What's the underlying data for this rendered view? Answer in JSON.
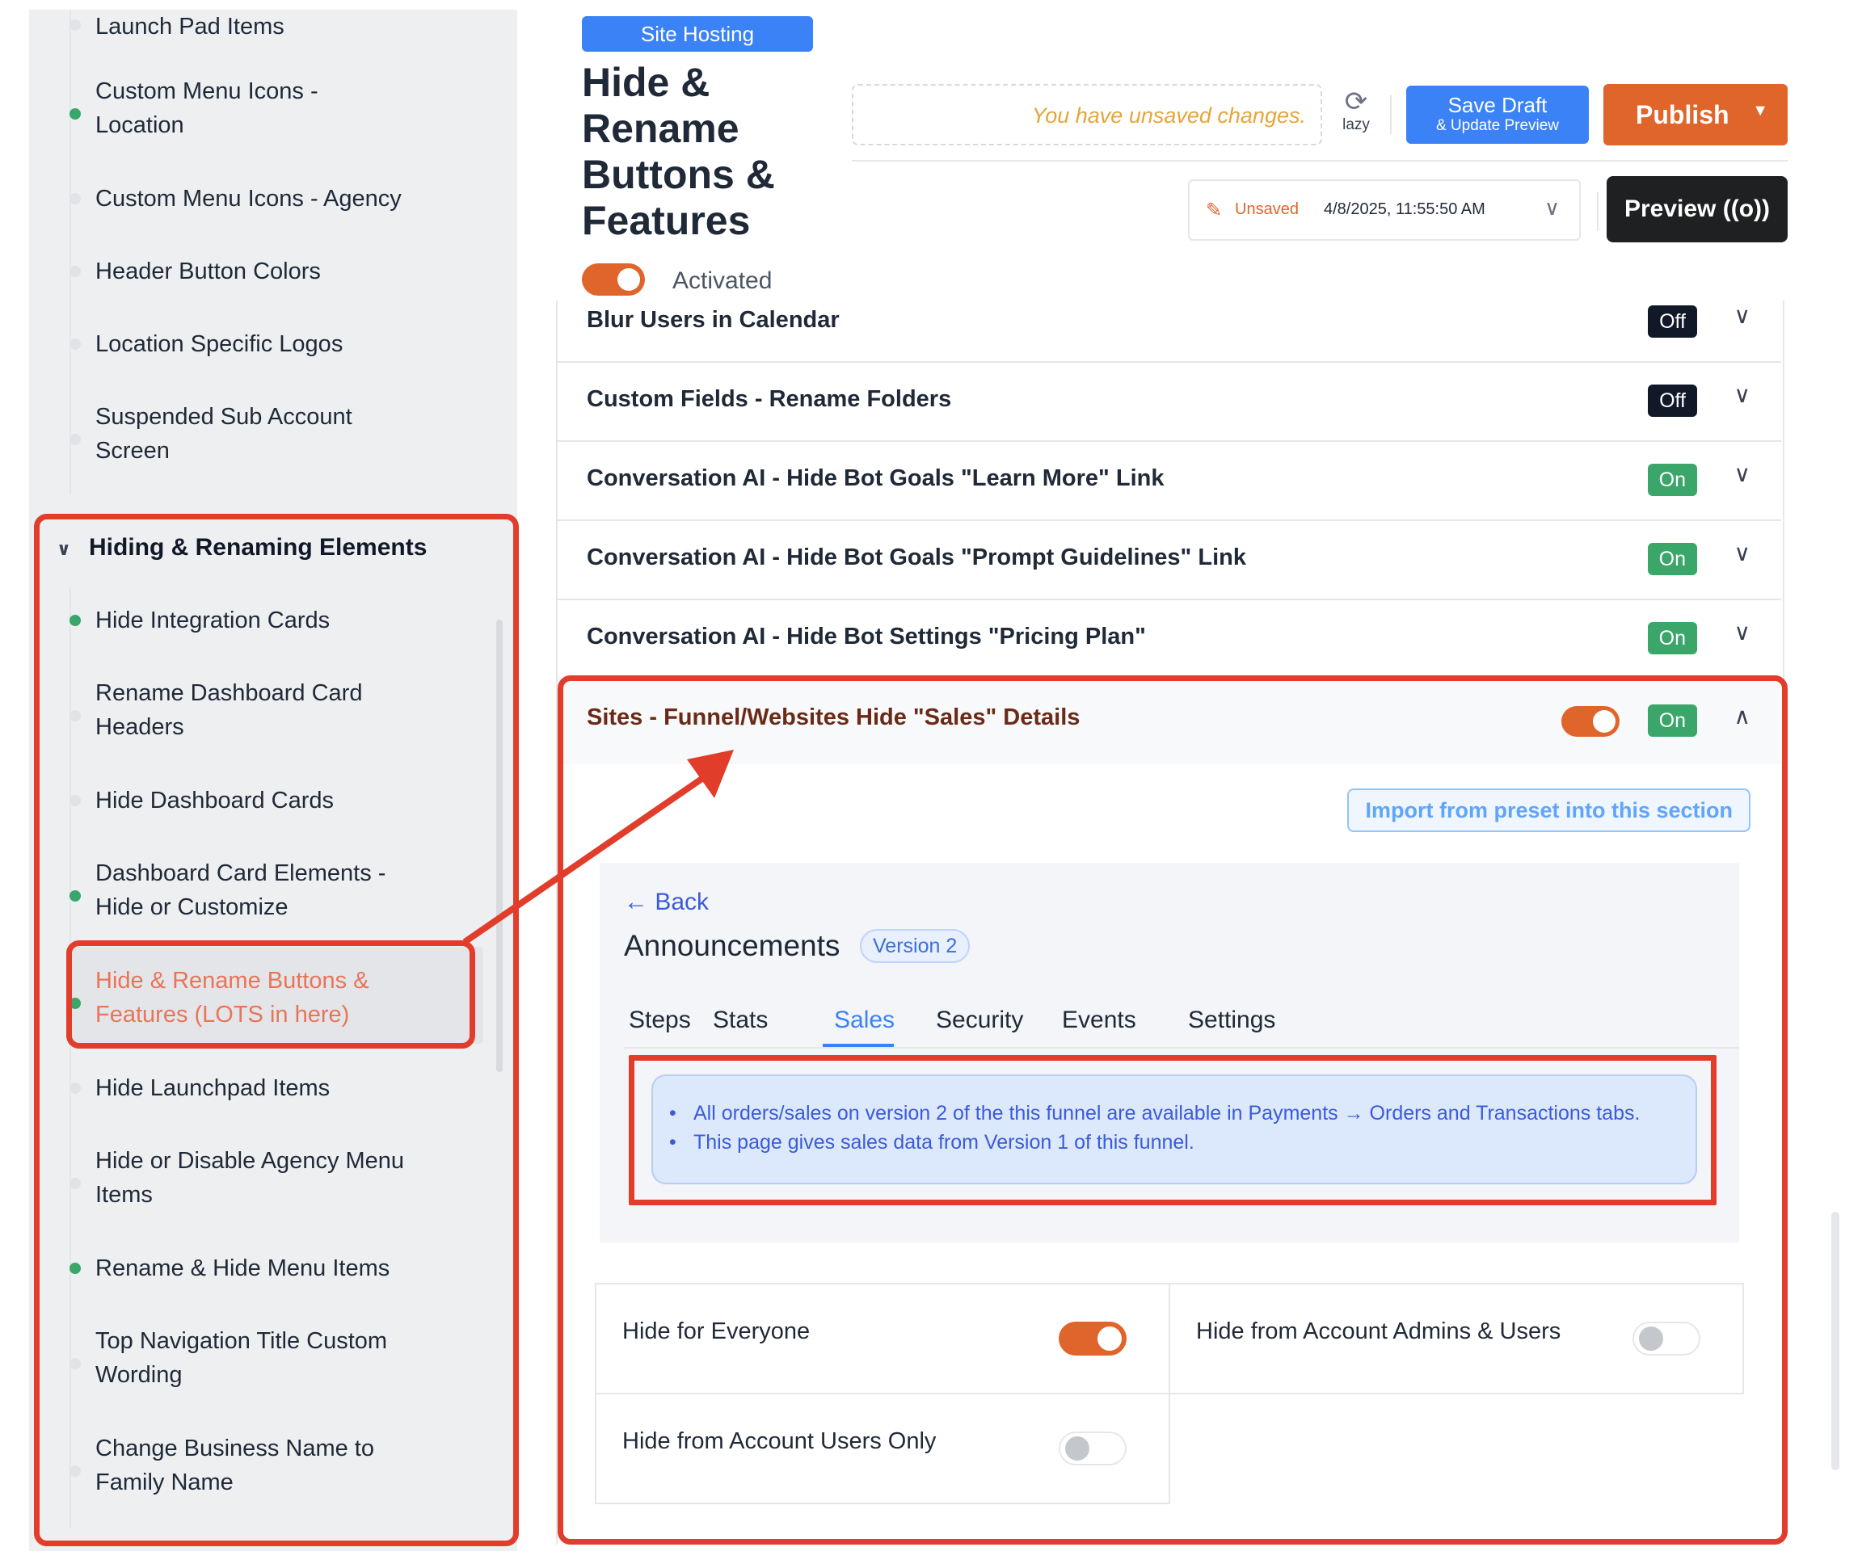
{
  "sidebar": {
    "items_top": [
      {
        "label": "Launch Pad Items",
        "dot": "plain"
      },
      {
        "label": "Custom Menu Icons - Location",
        "dot": "green"
      },
      {
        "label": "Custom Menu Icons - Agency",
        "dot": "plain"
      },
      {
        "label": "Header Button Colors",
        "dot": "plain"
      },
      {
        "label": "Location Specific Logos",
        "dot": "plain"
      },
      {
        "label": "Suspended Sub Account Screen",
        "dot": "plain"
      }
    ],
    "group_label": "Hiding & Renaming Elements",
    "items_group": [
      {
        "label": "Hide Integration Cards",
        "dot": "green"
      },
      {
        "label": "Rename Dashboard Card Headers",
        "dot": "plain"
      },
      {
        "label": "Hide Dashboard Cards",
        "dot": "plain"
      },
      {
        "label": "Dashboard Card Elements - Hide or Customize",
        "dot": "green"
      },
      {
        "label": "Hide & Rename Buttons & Features (LOTS in here)",
        "dot": "green",
        "active": true
      },
      {
        "label": "Hide Launchpad Items",
        "dot": "plain"
      },
      {
        "label": "Hide or Disable Agency Menu Items",
        "dot": "plain"
      },
      {
        "label": "Rename & Hide Menu Items",
        "dot": "green"
      },
      {
        "label": "Top Navigation Title Custom Wording",
        "dot": "plain"
      },
      {
        "label": "Change Business Name to Family Name",
        "dot": "plain"
      }
    ]
  },
  "header": {
    "badge": "Site Hosting",
    "title": "Hide & Rename Buttons & Features",
    "activated_label": "Activated",
    "unsaved_message": "You have unsaved changes.",
    "lazy_label": "lazy",
    "save_draft_line1": "Save Draft",
    "save_draft_line2": "& Update Preview",
    "publish_label": "Publish",
    "status_label": "Unsaved",
    "status_datetime": "4/8/2025, 11:55:50 AM",
    "preview_label": "Preview ((o))"
  },
  "features": [
    {
      "title": "Blur Users in Calendar",
      "state": "Off"
    },
    {
      "title": "Custom Fields - Rename Folders",
      "state": "Off"
    },
    {
      "title": "Conversation AI - Hide Bot Goals \"Learn More\" Link",
      "state": "On"
    },
    {
      "title": "Conversation AI - Hide Bot Goals \"Prompt Guidelines\" Link",
      "state": "On"
    },
    {
      "title": "Conversation AI - Hide Bot Settings \"Pricing Plan\"",
      "state": "On"
    }
  ],
  "expanded": {
    "title": "Sites - Funnel/Websites Hide \"Sales\" Details",
    "state": "On",
    "import_button": "Import from preset into this section",
    "embed": {
      "back": "Back",
      "title": "Announcements",
      "version": "Version 2",
      "tabs": [
        "Steps",
        "Stats",
        "Sales",
        "Security",
        "Events",
        "Settings"
      ],
      "selected_tab": "Sales",
      "info_lines": [
        "All orders/sales on version 2 of the this funnel are available in Payments → Orders and Transactions tabs.",
        "This page gives sales data from Version 1 of this funnel."
      ]
    },
    "options": [
      {
        "label": "Hide for Everyone",
        "on": true
      },
      {
        "label": "Hide from Account Admins & Users",
        "on": false
      },
      {
        "label": "Hide from Account Users Only",
        "on": false
      }
    ]
  },
  "colors": {
    "accent_orange": "#e0652b",
    "primary_blue": "#3b82f6",
    "status_green": "#3aa66a",
    "annotation_red": "#e23c2b"
  }
}
